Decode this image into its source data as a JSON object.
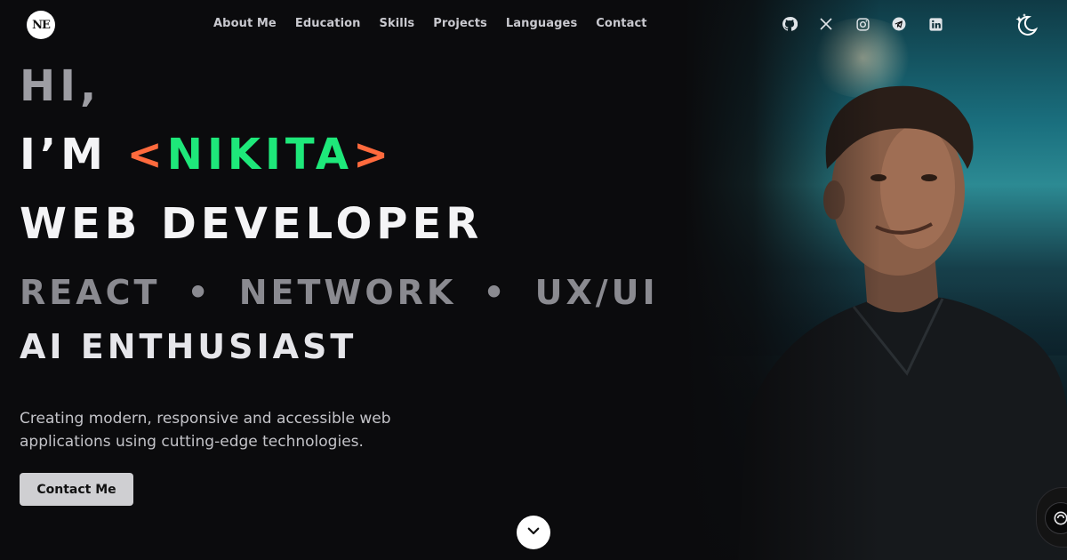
{
  "header": {
    "logo_text": "NE",
    "nav": [
      {
        "label": "About Me"
      },
      {
        "label": "Education"
      },
      {
        "label": "Skills"
      },
      {
        "label": "Projects"
      },
      {
        "label": "Languages"
      },
      {
        "label": "Contact"
      }
    ],
    "socials": [
      "github-icon",
      "x-icon",
      "instagram-icon",
      "telegram-icon",
      "linkedin-icon"
    ],
    "theme_toggle_icon": "moon-stars-icon"
  },
  "hero": {
    "greeting": "HI,",
    "intro_prefix": "I’M ",
    "name_open": "<",
    "name": "NIKITA",
    "name_close": ">",
    "role": "WEB DEVELOPER",
    "skills": [
      "REACT",
      "NETWORK",
      "UX/UI"
    ],
    "skill_separator": "•",
    "tagline": "AI ENTHUSIAST",
    "description": "Creating modern, responsive and accessible web applications using cutting-edge technologies.",
    "cta_label": "Contact Me"
  },
  "colors": {
    "background": "#0b0b0d",
    "accent_green": "#1ee87a",
    "accent_orange": "#ff6a3d"
  },
  "icons": {
    "scroll_down": "chevron-down-icon",
    "chat": "chat-assistant-icon",
    "photo": "portrait-photo"
  }
}
